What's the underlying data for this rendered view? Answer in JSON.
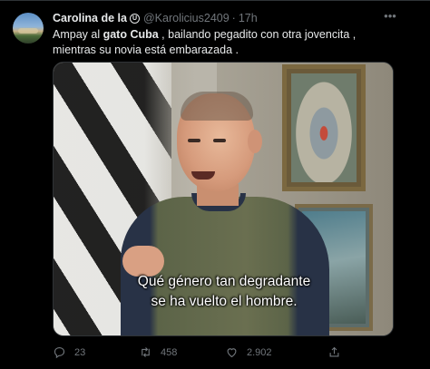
{
  "tweet": {
    "author_name": "Carolina de la",
    "author_badge": "U",
    "handle": "@Karolicius2409",
    "separator": "·",
    "time": "17h",
    "more_icon": "more-horizontal-icon",
    "text_parts": [
      "Ampay al ",
      "gato Cuba",
      " , bailando pegadito con otra jovencita , mientras su novia está embarazada ."
    ],
    "media": {
      "subtitle_line1": "Qué género tan degradante",
      "subtitle_line2": "se ha vuelto el hombre."
    },
    "actions": {
      "reply_count": "23",
      "retweet_count": "458",
      "like_count": "2.902",
      "share_label": ""
    }
  },
  "colors": {
    "background": "#000000",
    "text_primary": "#e7e9ea",
    "text_secondary": "#71767b",
    "border": "#2f3336"
  }
}
